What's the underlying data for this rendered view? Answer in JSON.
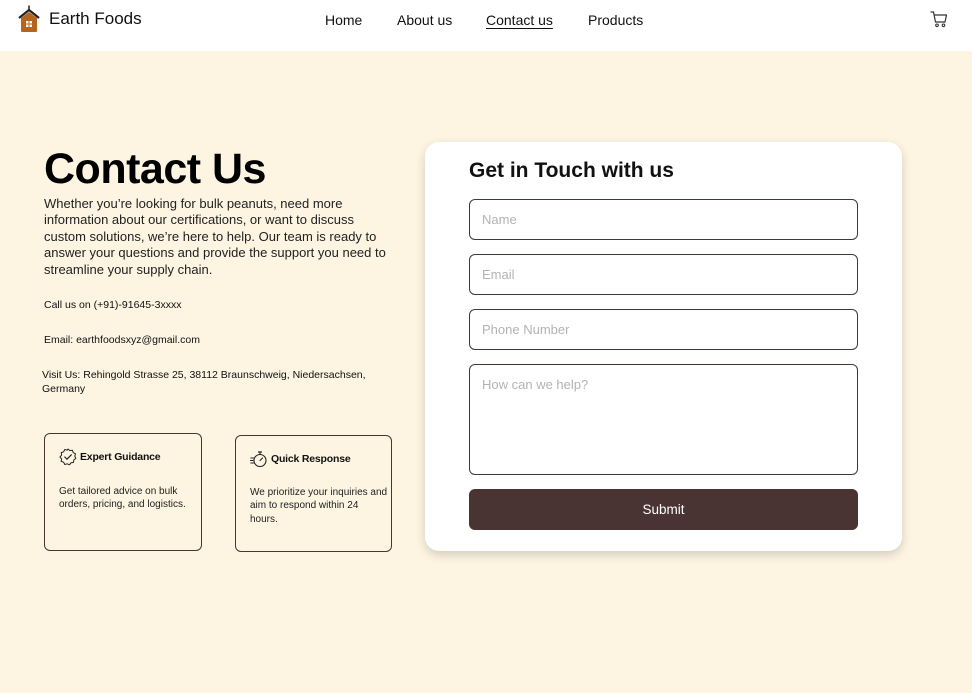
{
  "brand": {
    "name": "Earth Foods",
    "icon": "house-icon",
    "accent": "#b5651d"
  },
  "nav": {
    "home": "Home",
    "about": "About us",
    "contact": "Contact us",
    "products": "Products",
    "active": "contact",
    "cart_icon": "cart-icon"
  },
  "contact": {
    "title": "Contact Us",
    "intro": "Whether you’re looking for bulk peanuts, need more information about our certifications, or want to discuss custom solutions, we’re here to help. Our team is ready to answer your questions and provide the support you need to streamline your supply chain.",
    "call": "Call us on (+91)-91645-3xxxx",
    "email": "Email: earthfoodsxyz@gmail.com",
    "visit": "Visit Us: Rehingold Strasse 25, 38112 Braunschweig, Niedersachsen, Germany"
  },
  "features": [
    {
      "icon": "badge-check-icon",
      "title": "Expert Guidance",
      "text": "Get tailored advice on bulk orders, pricing, and logistics."
    },
    {
      "icon": "stopwatch-icon",
      "title": "Quick Response",
      "text": "We prioritize your inquiries and aim to respond within 24 hours."
    }
  ],
  "form": {
    "title": "Get in Touch with us",
    "name_placeholder": "Name",
    "email_placeholder": "Email",
    "phone_placeholder": "Phone Number",
    "help_placeholder": "How can we help?",
    "submit_label": "Submit"
  },
  "colors": {
    "background": "#fdf4e1",
    "primary": "#4a3333",
    "card": "#ffffff"
  }
}
